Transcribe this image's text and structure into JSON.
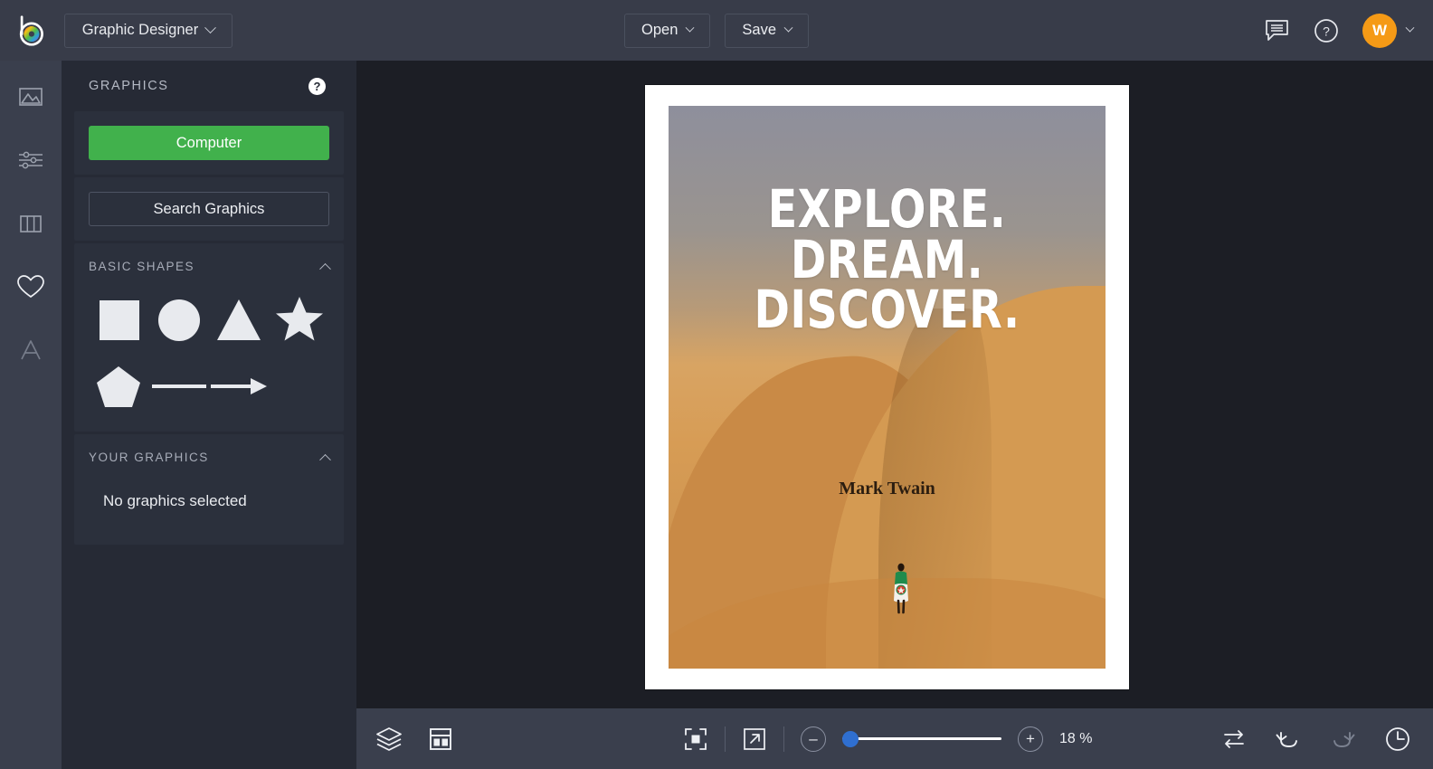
{
  "app": {
    "logo_icon": "color-wheel-b-logo",
    "switcher_label": "Graphic Designer"
  },
  "topbar": {
    "open_label": "Open",
    "save_label": "Save",
    "comments_icon": "comment-icon",
    "help_icon": "question-circle-icon",
    "avatar_initial": "W",
    "avatar_color": "#f59a16",
    "chevron_icon": "chevron-down-icon"
  },
  "rail": {
    "items": [
      {
        "name": "sidebar-item-image",
        "icon": "image-icon",
        "active": false
      },
      {
        "name": "sidebar-item-adjust",
        "icon": "sliders-icon",
        "active": false
      },
      {
        "name": "sidebar-item-layouts",
        "icon": "columns-icon",
        "active": false
      },
      {
        "name": "sidebar-item-graphics",
        "icon": "heart-icon",
        "active": true
      },
      {
        "name": "sidebar-item-text",
        "icon": "text-a-icon",
        "active": false
      }
    ]
  },
  "panel": {
    "title": "GRAPHICS",
    "help_icon": "question-mark-badge-icon",
    "computer_button": "Computer",
    "computer_button_color": "#41b14c",
    "search_button": "Search Graphics",
    "basic_shapes": {
      "title": "BASIC SHAPES",
      "collapse_icon": "chevron-up-icon",
      "shapes": [
        {
          "name": "shape-square",
          "icon": "square-icon"
        },
        {
          "name": "shape-circle",
          "icon": "circle-icon"
        },
        {
          "name": "shape-triangle",
          "icon": "triangle-icon"
        },
        {
          "name": "shape-star",
          "icon": "star-icon"
        },
        {
          "name": "shape-pentagon",
          "icon": "pentagon-icon"
        },
        {
          "name": "shape-line",
          "icon": "line-icon"
        },
        {
          "name": "shape-arrow",
          "icon": "arrow-right-icon"
        }
      ]
    },
    "your_graphics": {
      "title": "YOUR GRAPHICS",
      "collapse_icon": "chevron-up-icon",
      "empty_message": "No graphics selected"
    }
  },
  "canvas": {
    "design": {
      "quote_lines": [
        "EXPLORE.",
        "DREAM.",
        "DISCOVER."
      ],
      "author": "Mark Twain",
      "background": "desert-dune-photo",
      "page_color": "#ffffff"
    }
  },
  "bottombar": {
    "layers_icon": "layers-icon",
    "layout_icon": "layout-template-icon",
    "fit_icon": "fit-to-screen-icon",
    "expand_icon": "expand-arrow-icon",
    "zoom_out_icon": "minus-icon",
    "zoom_out_label": "–",
    "zoom_in_icon": "plus-icon",
    "zoom_in_label": "+",
    "zoom_value": "18 %",
    "zoom_slider_position": 0,
    "swap_icon": "swap-arrows-icon",
    "undo_icon": "undo-arrow-icon",
    "redo_icon": "redo-arrow-icon",
    "history_icon": "history-clock-icon",
    "slider_color": "#2f6fd0"
  }
}
